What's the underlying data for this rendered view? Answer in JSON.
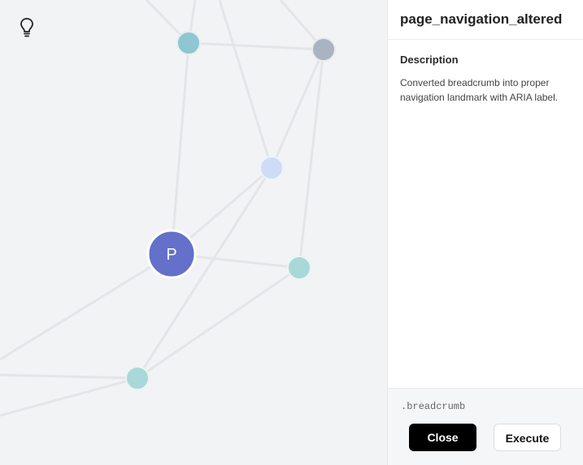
{
  "graph": {
    "focus_node_label": "P",
    "focus_node_color": "#6470c9",
    "node_colors": [
      "#8fc6d2",
      "#aab3c2",
      "#cfdcf5",
      "#a9d8d8",
      "#a9d8d8"
    ],
    "edge_color": "#e4e5e8"
  },
  "toolbar": {
    "hint_icon": "lightbulb-icon"
  },
  "panel": {
    "title": "page_navigation_altered",
    "description_heading": "Description",
    "description_text": "Converted breadcrumb into proper navigation landmark with ARIA label.",
    "selector": ".breadcrumb",
    "close_label": "Close",
    "execute_label": "Execute"
  }
}
